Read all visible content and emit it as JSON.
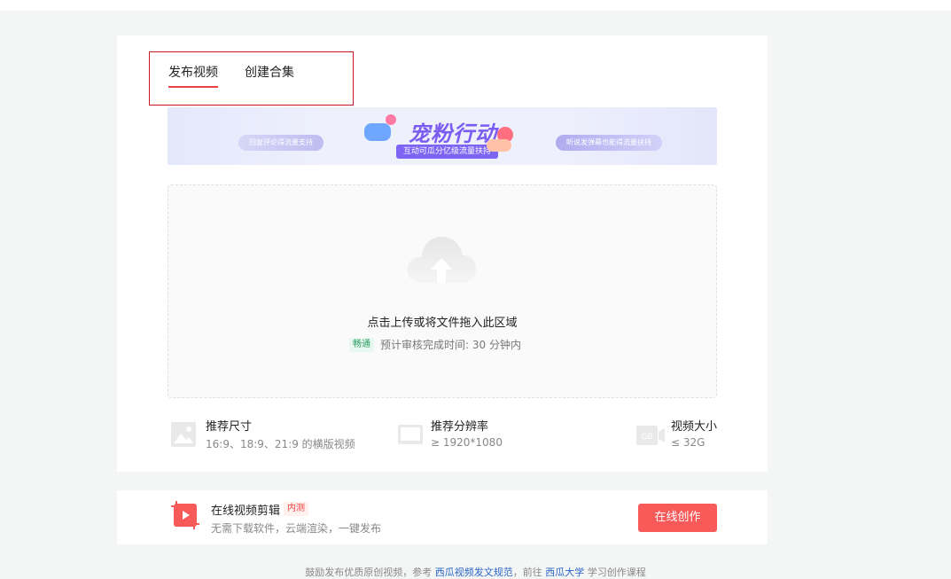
{
  "tabs": [
    {
      "label": "发布视频",
      "active": true
    },
    {
      "label": "创建合集",
      "active": false
    }
  ],
  "banner": {
    "title": "宠粉行动",
    "subtitle": "互动可瓜分亿级流量扶持",
    "left_text": "回复评论得流量支持",
    "right_text": "听说发弹幕也能得流量扶持"
  },
  "upload": {
    "icon": "cloud-upload-icon",
    "prompt": "点击上传或将文件拖入此区域",
    "badge": "畅通",
    "eta": "预计审核完成时间: 30 分钟内"
  },
  "specs": [
    {
      "icon": "image-icon",
      "title": "推荐尺寸",
      "desc": "16:9、18:9、21:9 的横版视频"
    },
    {
      "icon": "screen-icon",
      "title": "推荐分辨率",
      "desc": "≥ 1920*1080"
    },
    {
      "icon": "gb-video-icon",
      "icon_text": "GB",
      "title": "视频大小",
      "desc": "≤ 32G"
    }
  ],
  "editor": {
    "icon": "video-crop-icon",
    "title": "在线视频剪辑",
    "badge": "内测",
    "desc": "无需下载软件，云端渲染，一键发布",
    "button": "在线创作"
  },
  "footer": {
    "prefix": "鼓励发布优质原创视频，参考",
    "link1": "西瓜视频发文规范",
    "middle": "，前往",
    "link2": "西瓜大学",
    "suffix": "学习创作课程"
  },
  "colors": {
    "accent": "#f85959",
    "tab_underline": "#f04142",
    "highlight_box": "#c9171e",
    "link": "#2a66c6"
  }
}
